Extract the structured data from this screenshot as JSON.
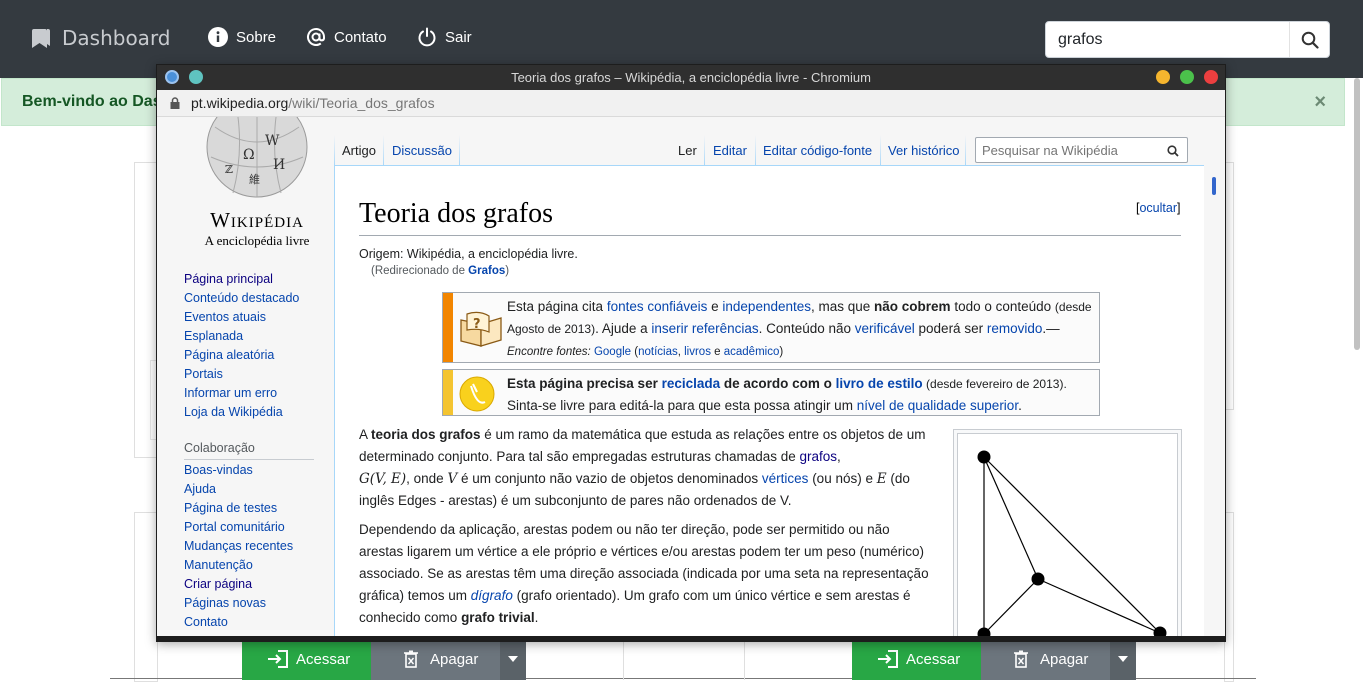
{
  "navbar": {
    "brand": "Dashboard",
    "links": [
      {
        "label": "Sobre",
        "icon": "info-circle-icon"
      },
      {
        "label": "Contato",
        "icon": "at-sign-icon"
      },
      {
        "label": "Sair",
        "icon": "power-icon"
      }
    ],
    "search_value": "grafos"
  },
  "alert": {
    "text": "Bem-vindo ao Dash",
    "close": "×"
  },
  "cards": {
    "left": {
      "access_label": "Acessar",
      "delete_label": "Apagar"
    },
    "right": {
      "access_label": "Acessar",
      "delete_label": "Apagar"
    }
  },
  "browser": {
    "title": "Teoria dos grafos – Wikipédia, a enciclopédia livre - Chromium",
    "url_host": "pt.wikipedia.org",
    "url_path": "/wiki/Teoria_dos_grafos"
  },
  "wiki": {
    "wordmark": "Wikipédia",
    "tagline": "A enciclopédia livre",
    "nav": [
      "Página principal",
      "Conteúdo destacado",
      "Eventos atuais",
      "Esplanada",
      "Página aleatória",
      "Portais",
      "Informar um erro",
      "Loja da Wikipédia"
    ],
    "collab_heading": "Colaboração",
    "collab": [
      "Boas-vindas",
      "Ajuda",
      "Página de testes",
      "Portal comunitário",
      "Mudanças recentes",
      "Manutenção",
      "Criar página",
      "Páginas novas",
      "Contato"
    ],
    "tabs_left": [
      "Artigo",
      "Discussão"
    ],
    "tabs_right": [
      "Ler",
      "Editar",
      "Editar código-fonte",
      "Ver histórico"
    ],
    "search_placeholder": "Pesquisar na Wikipédia",
    "title": "Teoria dos grafos",
    "hide": "ocultar",
    "origin": "Origem: Wikipédia, a enciclopédia livre.",
    "redirect_prefix": "(Redirecionado de ",
    "redirect_link": "Grafos",
    "redirect_suffix": ")",
    "box1": {
      "t1": "Esta página cita ",
      "l1": "fontes confiáveis",
      "t2": " e ",
      "l2": "independentes",
      "t3": ", mas que ",
      "b1": "não cobrem",
      "t4": " todo o conteúdo ",
      "small1": "(desde Agosto de 2013)",
      "t5": ". Ajude a ",
      "l3": "inserir referências",
      "t6": ". Conteúdo não ",
      "l4": "verificável",
      "t7": " poderá ser ",
      "l5": "removido",
      "t8": ".—",
      "find": "Encontre fontes:",
      "g": "Google",
      "p1": " (",
      "n": "notícias",
      "c1": ", ",
      "lv": "livros",
      "e": " e ",
      "ac": "acadêmico",
      "p2": ")"
    },
    "box2": {
      "b1": "Esta página precisa ser ",
      "l1": "reciclada",
      "b2": " de acordo com o ",
      "l2": "livro de estilo",
      "small": " (desde fevereiro de 2013).",
      "t1": "Sinta-se livre para editá-la para que esta possa atingir um ",
      "l3": "nível de qualidade superior",
      "t2": "."
    },
    "para1": {
      "a": "A ",
      "bold": "teoria dos grafos",
      "t1": " é um ramo da matemática que estuda as relações entre os objetos de um determinado conjunto. Para tal são empregadas estruturas chamadas de ",
      "link": "grafos",
      "t2": ",",
      "math1": "G(V, E)",
      "t3": ", onde ",
      "math2": "V",
      "t4": " é um conjunto não vazio de objetos denominados ",
      "link2": "vértices",
      "t5": " (ou nós) e ",
      "math3": "E",
      "t6": " (do inglês Edges - arestas) é um subconjunto de pares não ordenados de V."
    },
    "para2": {
      "t1": "Dependendo da aplicação, arestas podem ou não ter direção, pode ser permitido ou não arestas ligarem um vértice a ele próprio e vértices e/ou arestas podem ter um peso (numérico) associado. Se as arestas têm uma direção associada (indicada por uma seta na representação gráfica) temos um ",
      "link": "dígrafo",
      "t2": " (grafo orientado). Um grafo com um único vértice e sem arestas é conhecido como ",
      "bold": "grafo trivial",
      "t3": "."
    }
  }
}
